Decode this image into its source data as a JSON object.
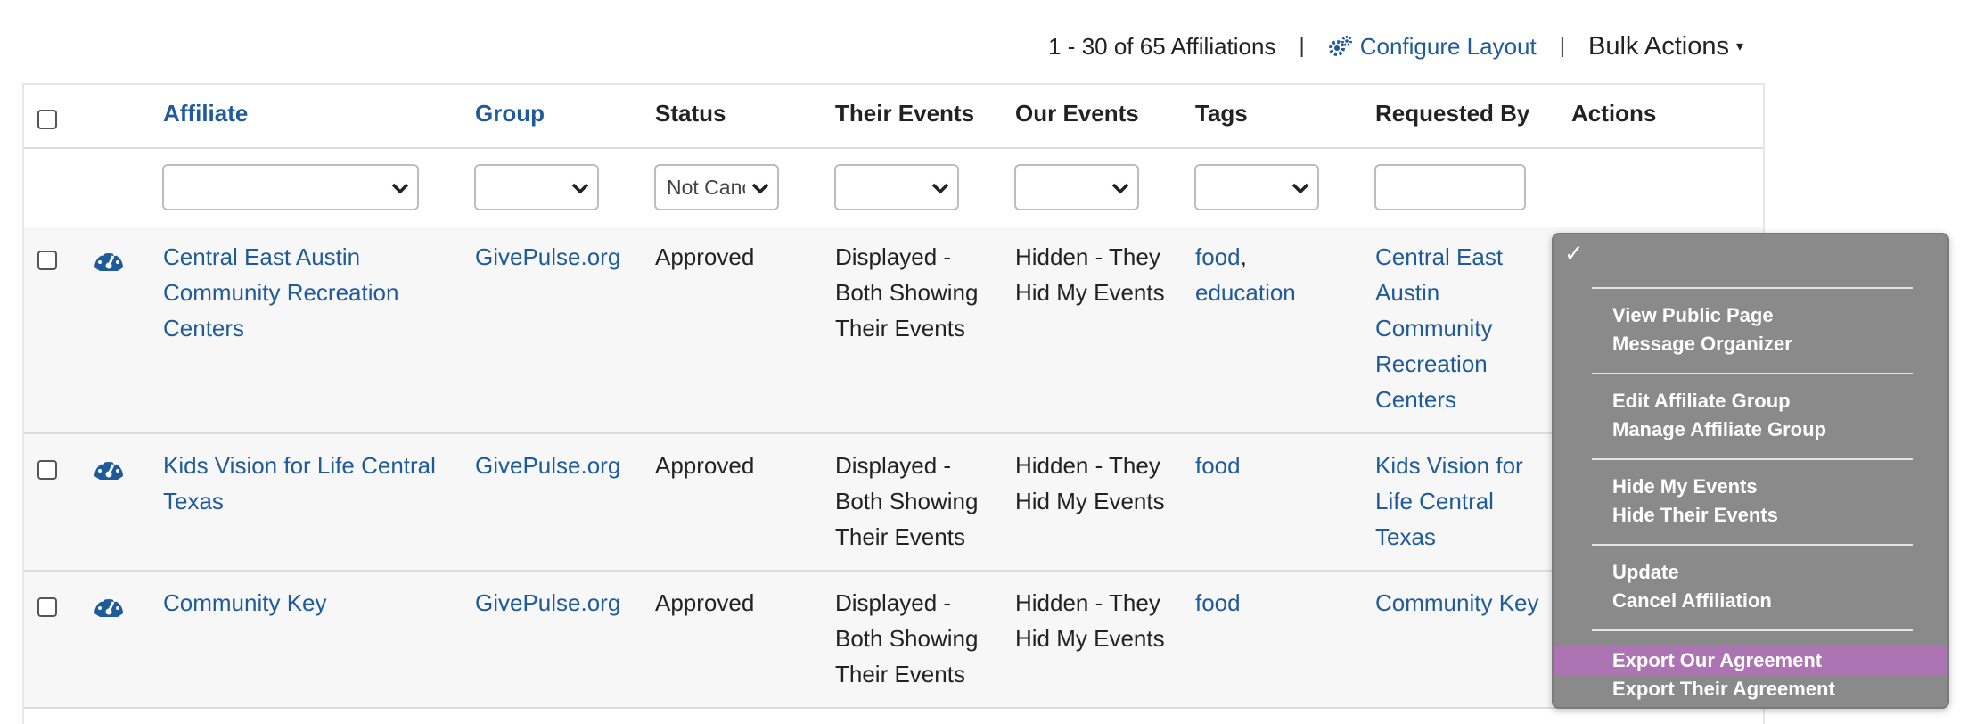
{
  "summary": {
    "count_text": "1 - 30 of 65 Affiliations",
    "separator": "|",
    "configure_label": "Configure Layout",
    "bulk_label": "Bulk Actions",
    "bulk_caret": "▾"
  },
  "headers": {
    "affiliate": "Affiliate",
    "group": "Group",
    "status": "Status",
    "their_events": "Their Events",
    "our_events": "Our Events",
    "tags": "Tags",
    "requested_by": "Requested By",
    "actions": "Actions"
  },
  "filters": {
    "status_value": "Not Canc"
  },
  "rows": [
    {
      "affiliate": [
        "Central East Austin",
        "Community Recreation",
        "Centers"
      ],
      "group": "GivePulse.org",
      "status": "Approved",
      "their_events": [
        "Displayed -",
        "Both Showing",
        "Their Events"
      ],
      "our_events": [
        "Hidden - They",
        "Hid My Events"
      ],
      "tags": [
        "food",
        ",",
        "education"
      ],
      "requested_by": [
        "Central East",
        "Austin",
        "Community",
        "Recreation",
        "Centers"
      ]
    },
    {
      "affiliate": [
        "Kids Vision for Life Central",
        "Texas"
      ],
      "group": "GivePulse.org",
      "status": "Approved",
      "their_events": [
        "Displayed -",
        "Both Showing",
        "Their Events"
      ],
      "our_events": [
        "Hidden - They",
        "Hid My Events"
      ],
      "tags": [
        "food"
      ],
      "requested_by": [
        "Kids Vision for",
        "Life Central",
        "Texas"
      ]
    },
    {
      "affiliate": [
        "Community Key"
      ],
      "group": "GivePulse.org",
      "status": "Approved",
      "their_events": [
        "Displayed -",
        "Both Showing",
        "Their Events"
      ],
      "our_events": [
        "Hidden - They",
        "Hid My Events"
      ],
      "tags": [
        "food"
      ],
      "requested_by": [
        "Community Key"
      ]
    }
  ],
  "actions_menu": {
    "check": "✓",
    "items": [
      "View Public Page",
      "Message Organizer",
      "Edit Affiliate Group",
      "Manage Affiliate Group",
      "Hide My Events",
      "Hide Their Events",
      "Update",
      "Cancel Affiliation",
      "Export Our Agreement",
      "Export Their Agreement"
    ],
    "highlighted": "Export Our Agreement"
  },
  "colors": {
    "link": "#1f5a99",
    "menu_bg": "#8a8a8a",
    "menu_highlight": "#ad74b3",
    "row_shade": "#f7f7f7"
  },
  "icons": {
    "configure": "gears-icon",
    "row_dashboard": "dashboard-gauge-icon"
  }
}
